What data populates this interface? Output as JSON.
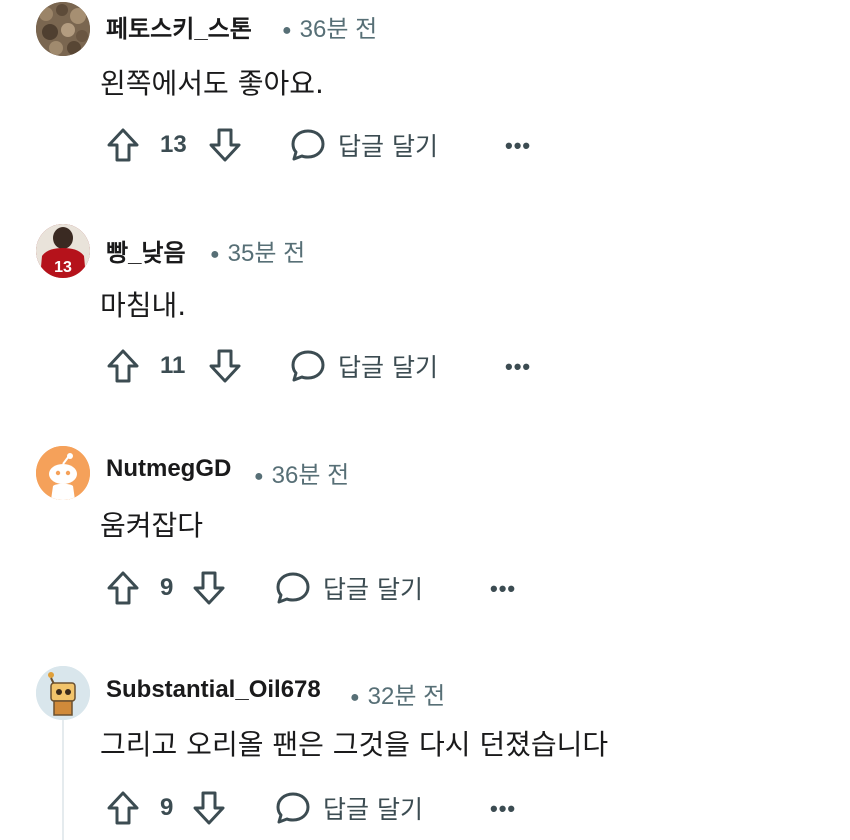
{
  "comments": [
    {
      "username": "페토스키_스톤",
      "time": "36분 전",
      "text": "왼쪽에서도 좋아요.",
      "votes": "13",
      "reply_label": "답글 달기",
      "more_label": "•••",
      "avatar_icon": "stone-avatar-icon"
    },
    {
      "username": "빵_낮음",
      "time": "35분 전",
      "text": "마침내.",
      "votes": "11",
      "reply_label": "답글 달기",
      "more_label": "•••",
      "avatar_icon": "football-player-avatar-icon"
    },
    {
      "username": "NutmegGD",
      "time": "36분 전",
      "text": "움켜잡다",
      "votes": "9",
      "reply_label": "답글 달기",
      "more_label": "•••",
      "avatar_icon": "snoo-avatar-icon"
    },
    {
      "username": "Substantial_Oil678",
      "time": "32분 전",
      "text": "그리고 오리올 팬은 그것을 다시 던졌습니다",
      "votes": "9",
      "reply_label": "답글 달기",
      "more_label": "•••",
      "avatar_icon": "robot-avatar-icon"
    }
  ],
  "colors": {
    "text": "#1a1a1b",
    "meta": "#576f76",
    "icon": "#3c4c52",
    "orange_avatar": "#f5a15a"
  }
}
